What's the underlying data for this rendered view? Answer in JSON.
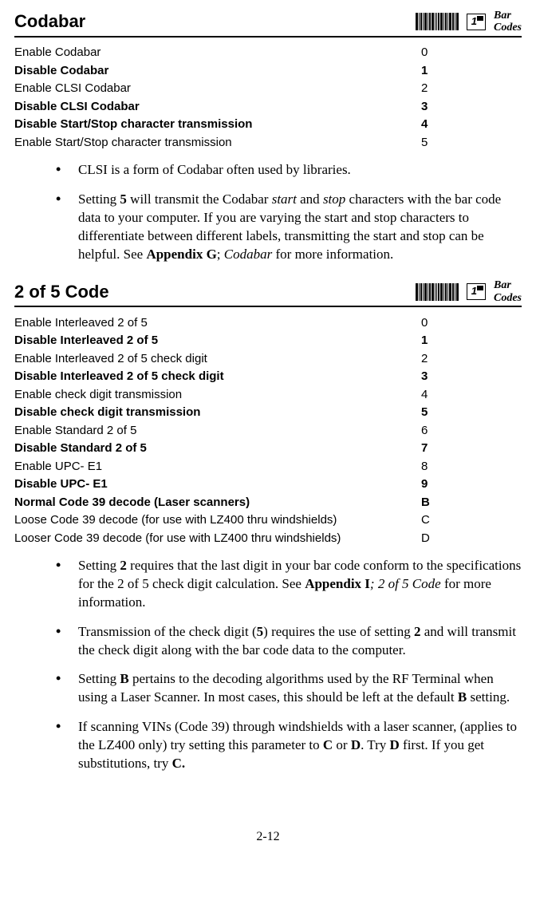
{
  "pageNumber": "2-12",
  "sections": [
    {
      "title": "Codabar",
      "keyNumber": "1",
      "sideLabel": "Bar Codes",
      "options": [
        {
          "label": "Enable Codabar",
          "value": "0",
          "bold": false
        },
        {
          "label": "Disable Codabar",
          "value": "1",
          "bold": true
        },
        {
          "label": "Enable CLSI Codabar",
          "value": "2",
          "bold": false
        },
        {
          "label": "Disable CLSI Codabar",
          "value": "3",
          "bold": true
        },
        {
          "label": "Disable Start/Stop character transmission",
          "value": "4",
          "bold": true
        },
        {
          "label": "Enable Start/Stop character transmission",
          "value": "5",
          "bold": false
        }
      ],
      "bullets": [
        {
          "html": "CLSI is a form of Codabar often used by libraries."
        },
        {
          "html": "Setting <b>5</b> will transmit the Codabar <i>start</i> and <i>stop</i> characters with the bar code data to your computer.  If you are varying the start and stop characters to differentiate between different labels, transmitting the start and stop can be helpful.  See <b>Appendix G</b>; <i>Codabar</i> for more information."
        }
      ]
    },
    {
      "title": "2 of 5 Code",
      "keyNumber": "1",
      "sideLabel": "Bar Codes",
      "options": [
        {
          "label": "Enable Interleaved 2 of 5",
          "value": "0",
          "bold": false
        },
        {
          "label": "Disable Interleaved 2 of 5",
          "value": "1",
          "bold": true
        },
        {
          "label": "Enable Interleaved 2 of 5 check digit",
          "value": "2",
          "bold": false
        },
        {
          "label": "Disable Interleaved 2 of 5 check digit",
          "value": "3",
          "bold": true
        },
        {
          "label": "Enable check digit transmission",
          "value": "4",
          "bold": false
        },
        {
          "label": "Disable check digit transmission",
          "value": "5",
          "bold": true
        },
        {
          "label": "Enable Standard 2 of 5",
          "value": "6",
          "bold": false
        },
        {
          "label": "Disable Standard 2 of 5",
          "value": "7",
          "bold": true
        },
        {
          "label": "Enable UPC- E1",
          "value": "8",
          "bold": false
        },
        {
          "label": "Disable UPC- E1",
          "value": "9",
          "bold": true
        },
        {
          "label": "Normal Code 39 decode (Laser scanners)",
          "value": "B",
          "bold": true
        },
        {
          "label": "Loose Code 39 decode (for use with LZ400 thru windshields)",
          "value": "C",
          "bold": false
        },
        {
          "label": "Looser Code 39 decode (for use with LZ400 thru windshields)",
          "value": "D",
          "bold": false
        }
      ],
      "bullets": [
        {
          "html": "Setting <b>2</b> requires that the last digit in your bar code conform to the specifications for the 2 of 5 check digit calculation.  See <b>Appendix I</b><i>; 2 of 5 Code</i> for more information."
        },
        {
          "html": "Transmission of the check digit (<b>5</b>) requires the use of setting <b>2</b> and will transmit the check digit along with the bar code data to the computer."
        },
        {
          "html": "Setting <b>B</b> pertains to the decoding algorithms used by the RF Terminal when using a Laser Scanner. In most cases, this should be left at the default <b>B</b> setting."
        },
        {
          "html": "If scanning VINs (Code 39) through windshields with a laser scanner, (applies to the LZ400 only) try setting this parameter to <b>C</b> or <b>D</b>. Try <b>D</b> first. If you get substitutions, try <b>C.</b>"
        }
      ]
    }
  ]
}
